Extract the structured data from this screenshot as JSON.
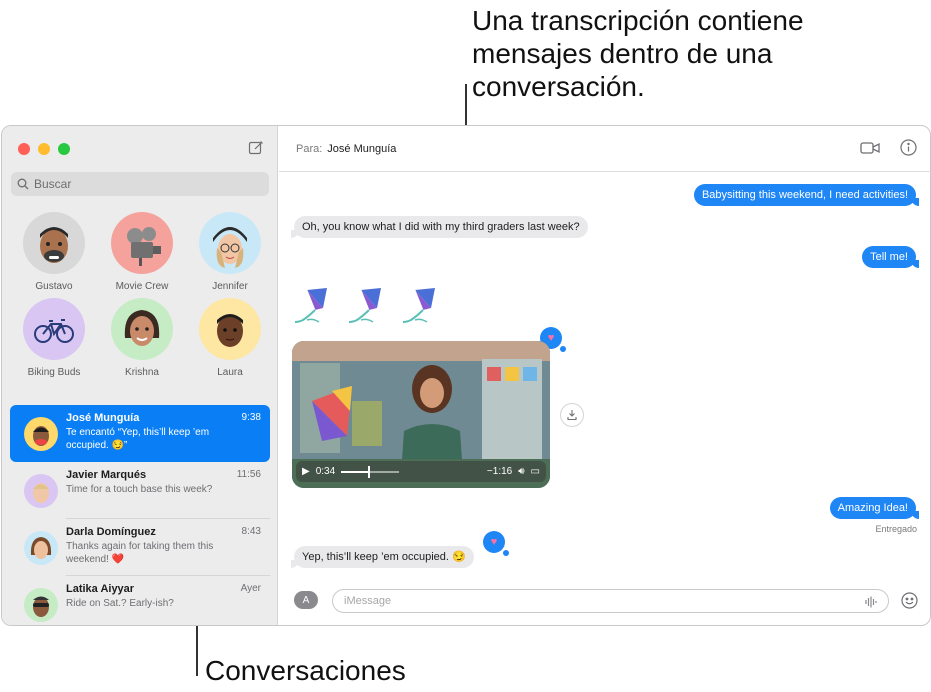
{
  "callouts": {
    "top": "Una transcripción contiene mensajes dentro de una conversación.",
    "bottom": "Conversaciones"
  },
  "sidebar": {
    "search_placeholder": "Buscar",
    "pinned": [
      {
        "name": "Gustavo",
        "color": "#d8d8d8"
      },
      {
        "name": "Movie Crew",
        "color": "#f6a29c"
      },
      {
        "name": "Jennifer",
        "color": "#c9e8f7"
      },
      {
        "name": "Biking Buds",
        "color": "#d9c6f3"
      },
      {
        "name": "Krishna",
        "color": "#c5ecc4"
      },
      {
        "name": "Laura",
        "color": "#fde7a3"
      }
    ],
    "conversations": [
      {
        "name": "José Munguía",
        "time": "9:38",
        "preview": "Te encantó “Yep, this’ll keep ’em occupied. 😏”",
        "selected": true
      },
      {
        "name": "Javier Marqués",
        "time": "11:56",
        "preview": "Time for a touch base this week?"
      },
      {
        "name": "Darla Domínguez",
        "time": "8:43",
        "preview": "Thanks again for taking them this weekend! ❤️"
      },
      {
        "name": "Latika Aiyyar",
        "time": "Ayer",
        "preview": "Ride on Sat.? Early-ish?"
      }
    ]
  },
  "header": {
    "to_label": "Para:",
    "recipient": "José Munguía"
  },
  "messages": {
    "m1": "Babysitting this weekend, I need activities!",
    "m2": "Oh, you know what I did with my third graders last week?",
    "m3": "Tell me!",
    "m4": "Amazing Idea!",
    "m5": "Yep, this’ll keep ’em occupied. 😏",
    "delivered": "Entregado"
  },
  "video": {
    "elapsed": "0:34",
    "remaining": "−1:16",
    "progress": 0.31
  },
  "composer": {
    "placeholder": "iMessage"
  },
  "colors": {
    "accent": "#0a7ff5",
    "bubble_out": "#1f86f5",
    "bubble_in": "#e9e9eb"
  }
}
